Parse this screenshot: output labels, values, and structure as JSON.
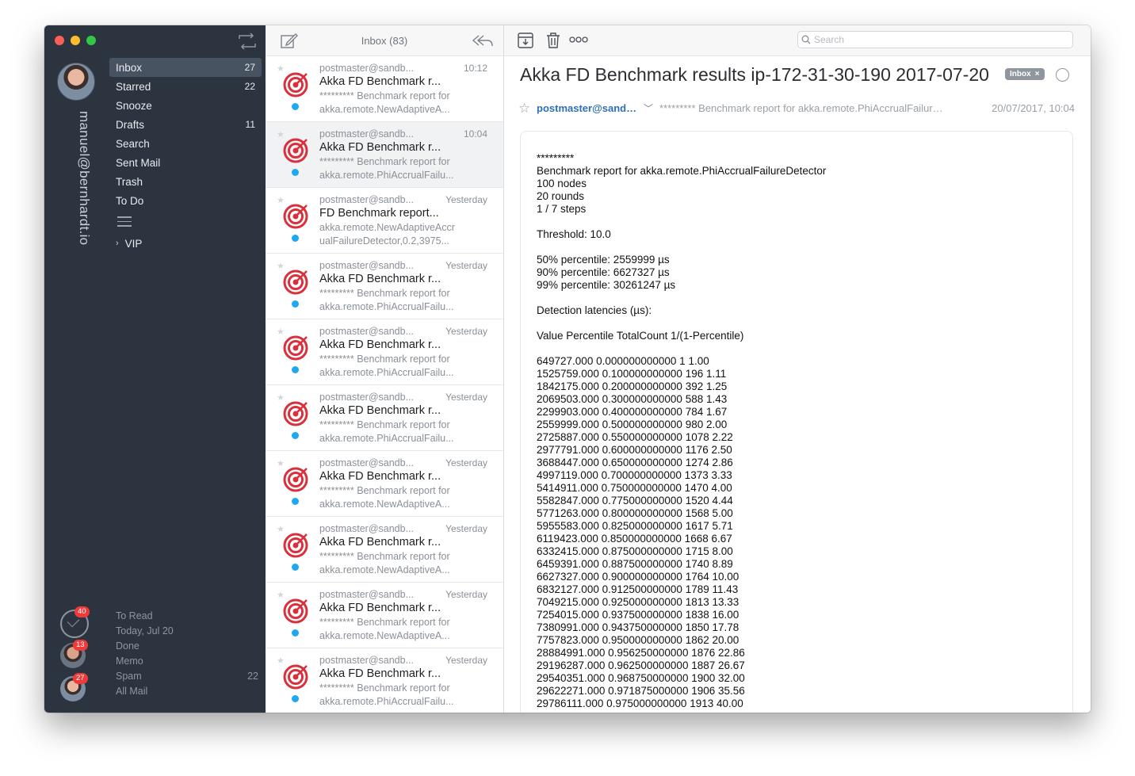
{
  "sidebar": {
    "account_email": "manuel@bernhardt.io",
    "folders": [
      {
        "label": "Inbox",
        "count": "27",
        "active": true
      },
      {
        "label": "Starred",
        "count": "22"
      },
      {
        "label": "Snooze",
        "count": ""
      },
      {
        "label": "Drafts",
        "count": "11"
      },
      {
        "label": "Search",
        "count": ""
      },
      {
        "label": "Sent Mail",
        "count": ""
      },
      {
        "label": "Trash",
        "count": ""
      },
      {
        "label": "To Do",
        "count": ""
      }
    ],
    "vip_label": "VIP",
    "quick_filters": [
      {
        "label": "To Read",
        "count": ""
      },
      {
        "label": "Today, Jul 20",
        "count": ""
      },
      {
        "label": "Done",
        "count": ""
      },
      {
        "label": "Memo",
        "count": ""
      },
      {
        "label": "Spam",
        "count": "22"
      },
      {
        "label": "All Mail",
        "count": ""
      }
    ],
    "account_badges": [
      "40",
      "13",
      "27"
    ]
  },
  "list": {
    "title": "Inbox (83)",
    "messages": [
      {
        "from": "postmaster@sandb...",
        "time": "10:12",
        "subject": "Akka FD Benchmark r...",
        "p1": "********* Benchmark report for",
        "p2": "akka.remote.NewAdaptiveA..."
      },
      {
        "from": "postmaster@sandb...",
        "time": "10:04",
        "subject": "Akka FD Benchmark r...",
        "p1": "********* Benchmark report for",
        "p2": "akka.remote.PhiAccrualFailu..."
      },
      {
        "from": "postmaster@sandb...",
        "time": "Yesterday",
        "subject": "FD Benchmark report...",
        "p1": "akka.remote.NewAdaptiveAccr",
        "p2": "ualFailureDetector,0.2,3975..."
      },
      {
        "from": "postmaster@sandb...",
        "time": "Yesterday",
        "subject": "Akka FD Benchmark r...",
        "p1": "********* Benchmark report for",
        "p2": "akka.remote.PhiAccrualFailu..."
      },
      {
        "from": "postmaster@sandb...",
        "time": "Yesterday",
        "subject": "Akka FD Benchmark r...",
        "p1": "********* Benchmark report for",
        "p2": "akka.remote.PhiAccrualFailu..."
      },
      {
        "from": "postmaster@sandb...",
        "time": "Yesterday",
        "subject": "Akka FD Benchmark r...",
        "p1": "********* Benchmark report for",
        "p2": "akka.remote.PhiAccrualFailu..."
      },
      {
        "from": "postmaster@sandb...",
        "time": "Yesterday",
        "subject": "Akka FD Benchmark r...",
        "p1": "********* Benchmark report for",
        "p2": "akka.remote.NewAdaptiveA..."
      },
      {
        "from": "postmaster@sandb...",
        "time": "Yesterday",
        "subject": "Akka FD Benchmark r...",
        "p1": "********* Benchmark report for",
        "p2": "akka.remote.NewAdaptiveA..."
      },
      {
        "from": "postmaster@sandb...",
        "time": "Yesterday",
        "subject": "Akka FD Benchmark r...",
        "p1": "********* Benchmark report for",
        "p2": "akka.remote.NewAdaptiveA..."
      },
      {
        "from": "postmaster@sandb...",
        "time": "Yesterday",
        "subject": "Akka FD Benchmark r...",
        "p1": "********* Benchmark report for",
        "p2": "akka.remote.PhiAccrualFailu..."
      }
    ]
  },
  "reader": {
    "search_placeholder": "Search",
    "subject": "Akka FD Benchmark results ip-172-31-30-190 2017-07-20",
    "label": "Inbox",
    "label_close": "×",
    "sender": "postmaster@sandbox.mailgun.org",
    "snippet": "********* Benchmark report for akka.remote.PhiAccrualFailureDetector",
    "date": "20/07/2017, 10:04",
    "body_lines": [
      "*********",
      "Benchmark report for akka.remote.PhiAccrualFailureDetector",
      "100 nodes",
      "20 rounds",
      "1 / 7 steps",
      "",
      "Threshold: 10.0",
      "",
      "50% percentile: 2559999 µs",
      "90% percentile: 6627327 µs",
      "99% percentile: 30261247 µs",
      "",
      "Detection latencies (µs):",
      "",
      "Value Percentile TotalCount 1/(1-Percentile)",
      "",
      "649727.000 0.000000000000 1 1.00",
      "1525759.000 0.100000000000 196 1.11",
      "1842175.000 0.200000000000 392 1.25",
      "2069503.000 0.300000000000 588 1.43",
      "2299903.000 0.400000000000 784 1.67",
      "2559999.000 0.500000000000 980 2.00",
      "2725887.000 0.550000000000 1078 2.22",
      "2977791.000 0.600000000000 1176 2.50",
      "3688447.000 0.650000000000 1274 2.86",
      "4997119.000 0.700000000000 1373 3.33",
      "5414911.000 0.750000000000 1470 4.00",
      "5582847.000 0.775000000000 1520 4.44",
      "5771263.000 0.800000000000 1568 5.00",
      "5955583.000 0.825000000000 1617 5.71",
      "6119423.000 0.850000000000 1668 6.67",
      "6332415.000 0.875000000000 1715 8.00",
      "6459391.000 0.887500000000 1740 8.89",
      "6627327.000 0.900000000000 1764 10.00",
      "6832127.000 0.912500000000 1789 11.43",
      "7049215.000 0.925000000000 1813 13.33",
      "7254015.000 0.937500000000 1838 16.00",
      "7380991.000 0.943750000000 1850 17.78",
      "7757823.000 0.950000000000 1862 20.00",
      "28884991.000 0.956250000000 1876 22.86",
      "29196287.000 0.962500000000 1887 26.67",
      "29540351.000 0.968750000000 1900 32.00",
      "29622271.000 0.971875000000 1906 35.56",
      "29786111.000 0.975000000000 1913 40.00"
    ]
  },
  "colors": {
    "sidebar_bg": "#2c3440",
    "accent_blue": "#1fa8ef",
    "sender_link": "#2f6fb5",
    "badge_red": "#f03a3a",
    "target_red": "#d9303c"
  }
}
